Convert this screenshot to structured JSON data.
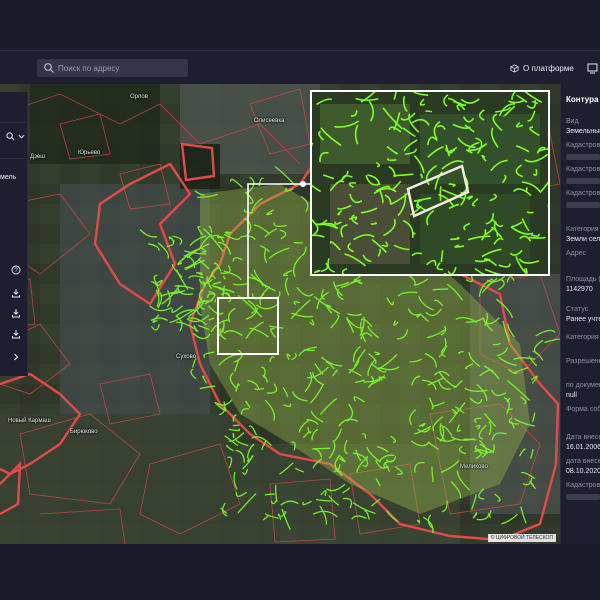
{
  "header": {
    "search_placeholder": "Поиск по адресу",
    "about_label": "О платформе"
  },
  "left_panel": {
    "label": "мель"
  },
  "map": {
    "labels": [
      "Орлов",
      "Олисеевка",
      "Юрьево",
      "Дзеш",
      "Бирюково",
      "Мелихово",
      "Новый Кармаш",
      "Сухово"
    ],
    "credit": "© ЦИФРОВОЙ ТЕЛЕСКОП"
  },
  "right_panel": {
    "title": "Контура",
    "fields": [
      {
        "label": "Вид",
        "value": "Земельный"
      },
      {
        "label": "Кадастрово",
        "value": ""
      },
      {
        "label": "Кадастрово",
        "value": ""
      },
      {
        "label": "Кадастрово",
        "value": ""
      },
      {
        "label": "Категория",
        "value": "Земли сель"
      },
      {
        "label": "Адрес",
        "value": ""
      },
      {
        "label": "Площадь (к",
        "value": "1142970"
      },
      {
        "label": "Статус",
        "value": "Ранее учте"
      },
      {
        "label": "Категория",
        "value": ""
      },
      {
        "label": "Разрешенн",
        "value": ""
      },
      {
        "label": "по докумен",
        "value": "null"
      },
      {
        "label": "Форма собс",
        "value": ""
      },
      {
        "label": "Дата внесе",
        "value": "16.01.2006"
      },
      {
        "label": "дата внесе",
        "value": "08.10.2020"
      },
      {
        "label": "Кадастрово",
        "value": ""
      }
    ]
  },
  "colors": {
    "background": "#1b1b2b",
    "panel": "#1e1e30",
    "parcel_green": "#7cff2a",
    "boundary_red": "#e34a4a",
    "highlight_white": "#ffffff"
  }
}
